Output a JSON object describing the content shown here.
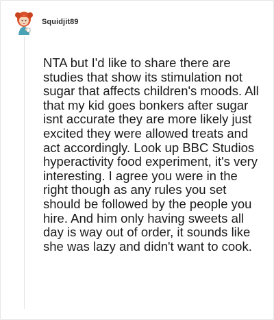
{
  "comment": {
    "username": "Squidjit89",
    "avatar_icon": "redhead-girl-avatar-icon",
    "text": "NTA but I'd like to share there are studies that show its stimulation not sugar that affects children's moods. All that my kid goes bonkers after sugar isnt accurate they are more likely just excited they were allowed treats and act accordingly. Look up BBC Studios hyperactivity food experiment, it's very interesting. I agree you were in the right though as any rules you set should be followed by the people you hire. And him only having sweets all day is way out of order, it sounds like she was lazy and didn't want to cook."
  },
  "colors": {
    "hair": "#d9502a",
    "skin": "#f6d3b8",
    "outfit": "#4aa3b5",
    "text": "#1a1a1a"
  }
}
